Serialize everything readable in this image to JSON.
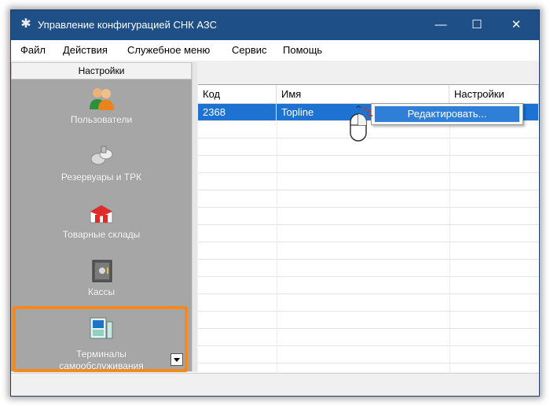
{
  "window": {
    "title": "Управление конфигурацией СНК АЗС",
    "controls": {
      "minimize": "—",
      "maximize": "☐",
      "close": "✕"
    }
  },
  "menu": {
    "items": [
      "Файл",
      "Действия",
      "Служебное меню",
      "Сервис",
      "Помощь"
    ]
  },
  "sidebar": {
    "header": "Настройки",
    "items": [
      {
        "label": "Пользователи",
        "icon": "users-icon"
      },
      {
        "label": "Резервуары и ТРК",
        "icon": "tanks-icon"
      },
      {
        "label": "Товарные склады",
        "icon": "warehouse-icon"
      },
      {
        "label": "Кассы",
        "icon": "safe-icon"
      },
      {
        "label": "Терминалы самообслуживания",
        "label_line1": "Терминалы",
        "label_line2": "самообслуживания",
        "icon": "terminal-icon",
        "highlighted": true
      }
    ]
  },
  "table": {
    "columns": [
      "Код",
      "Имя",
      "Настройки"
    ],
    "rows": [
      {
        "code": "2368",
        "name": "Topline",
        "settings": "",
        "selected": true
      }
    ]
  },
  "context_menu": {
    "items": [
      "Редактировать..."
    ]
  },
  "colors": {
    "titlebar": "#1e4f86",
    "selection": "#1e73d2",
    "highlight": "#f28a1e",
    "sidebar": "#a6a6a6"
  }
}
